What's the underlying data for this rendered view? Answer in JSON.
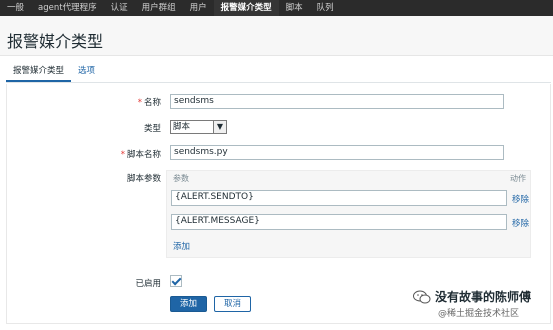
{
  "topnav": {
    "items": [
      {
        "label": "一般"
      },
      {
        "label": "agent代理程序"
      },
      {
        "label": "认证"
      },
      {
        "label": "用户群组"
      },
      {
        "label": "用户"
      },
      {
        "label": "报警媒介类型",
        "active": true
      },
      {
        "label": "脚本"
      },
      {
        "label": "队列"
      }
    ]
  },
  "page": {
    "title": "报警媒介类型"
  },
  "tabs": [
    {
      "label": "报警媒介类型",
      "active": true
    },
    {
      "label": "选项"
    }
  ],
  "form": {
    "name": {
      "label": "名称",
      "value": "sendsms"
    },
    "type": {
      "label": "类型",
      "value": "脚本"
    },
    "script_name": {
      "label": "脚本名称",
      "value": "sendsms.py"
    },
    "script_params": {
      "label": "脚本参数",
      "col_param": "参数",
      "col_action": "动作",
      "rows": [
        {
          "value": "{ALERT.SENDTO}",
          "action": "移除"
        },
        {
          "value": "{ALERT.MESSAGE}",
          "action": "移除"
        }
      ],
      "add_label": "添加"
    },
    "enabled": {
      "label": "已启用",
      "checked": true
    },
    "add_button": "添加",
    "cancel_button": "取消"
  },
  "watermark": {
    "title": "没有故事的陈师傅",
    "subtitle": "@稀土掘金技术社区"
  }
}
